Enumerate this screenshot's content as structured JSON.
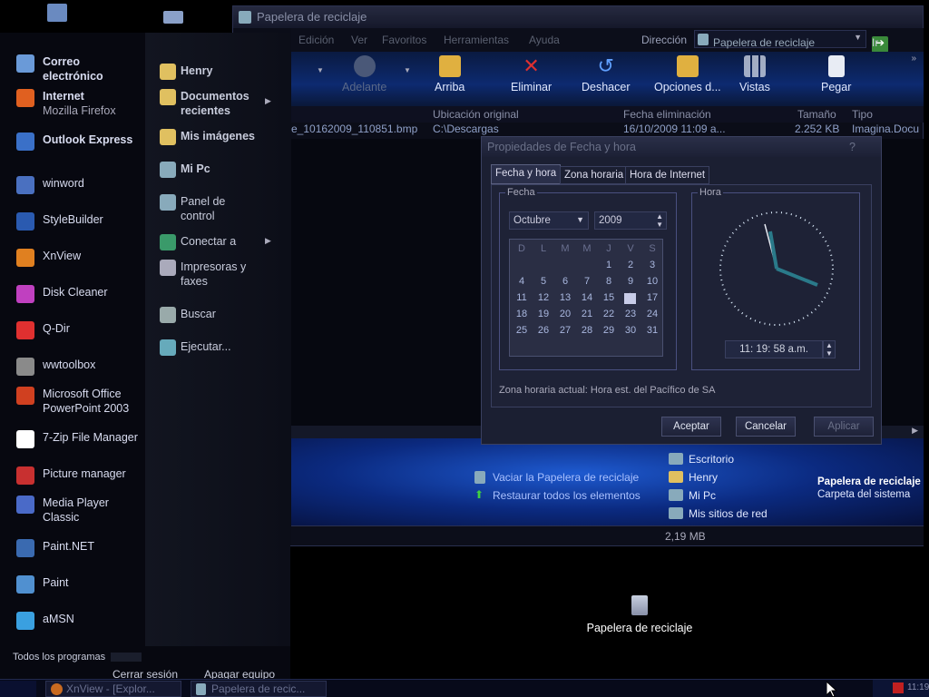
{
  "desktop": {
    "icons": [
      {
        "label": "Papelera de reciclaje",
        "icon": "recycle-bin-icon"
      }
    ]
  },
  "explorer": {
    "title": "Papelera de reciclaje",
    "menu": [
      "Edición",
      "Ver",
      "Favoritos",
      "Herramientas",
      "Ayuda"
    ],
    "address_label": "Dirección",
    "address_value": "Papelera de reciclaje",
    "go_label": "Ir",
    "toolbar": {
      "forward": "Adelante",
      "up": "Arriba",
      "delete": "Eliminar",
      "undo": "Deshacer",
      "options": "Opciones d...",
      "views": "Vistas",
      "paste": "Pegar"
    },
    "columns": {
      "original": "Ubicación original",
      "deleted": "Fecha eliminación",
      "size": "Tamaño",
      "type": "Tipo"
    },
    "row": {
      "name": "e_10162009_110851.bmp",
      "original": "C:\\Descargas",
      "deleted": "16/10/2009 11:09 a...",
      "size": "2.252 KB",
      "type": "Imagina.Docu"
    },
    "tasks": {
      "empty": "Vaciar la Papelera de reciclaje",
      "restore": "Restaurar todos los elementos"
    },
    "places": [
      "Escritorio",
      "Henry",
      "Mi Pc",
      "Mis sitios de red"
    ],
    "details": {
      "name": "Papelera de reciclaje",
      "desc": "Carpeta del sistema"
    },
    "status_size": "2,19 MB"
  },
  "dialog": {
    "title": "Propiedades de Fecha y hora",
    "help": "?",
    "tabs": [
      "Fecha y hora",
      "Zona horaria",
      "Hora de Internet"
    ],
    "date_group": "Fecha",
    "month": "Octubre",
    "year": "2009",
    "weekdays": [
      "D",
      "L",
      "M",
      "M",
      "J",
      "V",
      "S"
    ],
    "days": [
      "",
      "",
      "",
      "",
      "1",
      "2",
      "3",
      "4",
      "5",
      "6",
      "7",
      "8",
      "9",
      "10",
      "11",
      "12",
      "13",
      "14",
      "15",
      "16",
      "17",
      "18",
      "19",
      "20",
      "21",
      "22",
      "23",
      "24",
      "25",
      "26",
      "27",
      "28",
      "29",
      "30",
      "31"
    ],
    "selected_day": 16,
    "time_group": "Hora",
    "time": "11: 19: 58 a.m.",
    "timezone": "Zona horaria actual:  Hora est. del Pacífico de SA",
    "buttons": {
      "ok": "Aceptar",
      "cancel": "Cancelar",
      "apply": "Aplicar"
    }
  },
  "start_menu": {
    "pinned": [
      {
        "l1": "Correo",
        "l2": "electrónico"
      },
      {
        "l1": "Internet",
        "l2": "Mozilla Firefox"
      },
      {
        "l1": "Outlook Express",
        "l2": ""
      }
    ],
    "programs": [
      {
        "l1": "winword",
        "l2": ""
      },
      {
        "l1": "StyleBuilder",
        "l2": ""
      },
      {
        "l1": "XnView",
        "l2": ""
      },
      {
        "l1": "Disk Cleaner",
        "l2": ""
      },
      {
        "l1": "Q-Dir",
        "l2": ""
      },
      {
        "l1": "wwtoolbox",
        "l2": ""
      },
      {
        "l1": "Microsoft Office",
        "l2": "PowerPoint 2003"
      },
      {
        "l1": "7-Zip File Manager",
        "l2": ""
      },
      {
        "l1": "Picture manager",
        "l2": ""
      },
      {
        "l1": "Media Player",
        "l2": "Classic"
      },
      {
        "l1": "Paint.NET",
        "l2": ""
      },
      {
        "l1": "Paint",
        "l2": ""
      },
      {
        "l1": "aMSN",
        "l2": ""
      }
    ],
    "right": [
      {
        "l1": "Henry",
        "l2": ""
      },
      {
        "l1": "Documentos",
        "l2": "recientes"
      },
      {
        "l1": "Mis imágenes",
        "l2": ""
      },
      {
        "l1": "Mi Pc",
        "l2": ""
      },
      {
        "l1": "Panel de",
        "l2": "control"
      },
      {
        "l1": "Conectar a",
        "l2": ""
      },
      {
        "l1": "Impresoras y",
        "l2": "faxes"
      },
      {
        "l1": "Buscar",
        "l2": ""
      },
      {
        "l1": "Ejecutar...",
        "l2": ""
      }
    ],
    "all_programs": "Todos los programas",
    "logoff": "Cerrar sesión",
    "shutdown": "Apagar equipo"
  },
  "taskbar": {
    "tasks": [
      "XnView - [Explor...",
      "Papelera de recic..."
    ],
    "time": "11:19"
  }
}
